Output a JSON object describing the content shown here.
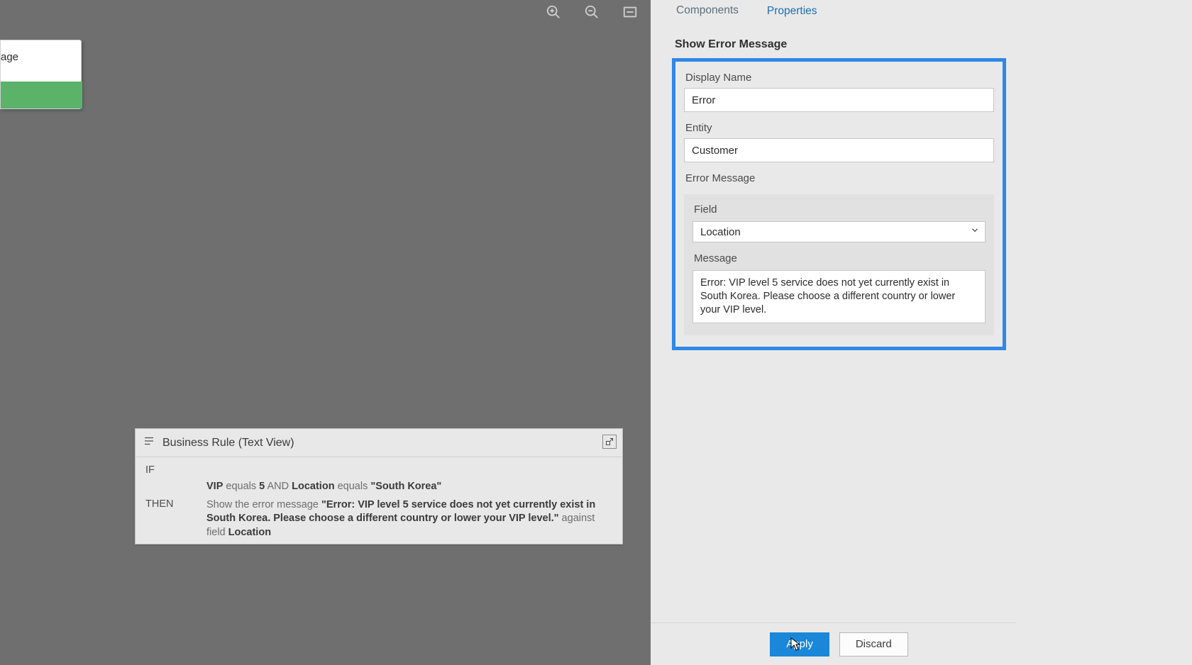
{
  "canvas": {
    "node_label": "age"
  },
  "rule_panel": {
    "title": "Business Rule (Text View)",
    "if_keyword": "IF",
    "then_keyword": "THEN",
    "condition": {
      "field1": "VIP",
      "op1": "equals",
      "val1": "5",
      "and": "AND",
      "field2": "Location",
      "op2": "equals",
      "val2": "\"South Korea\""
    },
    "action": {
      "prefix": "Show the error message ",
      "message": "\"Error: VIP level 5 service does not yet currently exist in South Korea. Please choose a different country or lower your VIP level.\"",
      "mid": " against field ",
      "field": "Location"
    }
  },
  "side": {
    "tabs": {
      "components": "Components",
      "properties": "Properties"
    },
    "section_title": "Show Error Message",
    "display_name": {
      "label": "Display Name",
      "value": "Error"
    },
    "entity": {
      "label": "Entity",
      "value": "Customer"
    },
    "error_message_label": "Error Message",
    "field": {
      "label": "Field",
      "value": "Location"
    },
    "message": {
      "label": "Message",
      "value": "Error: VIP level 5 service does not yet currently exist in South Korea. Please choose a different country or lower your VIP level."
    },
    "buttons": {
      "apply": "Apply",
      "discard": "Discard"
    }
  }
}
